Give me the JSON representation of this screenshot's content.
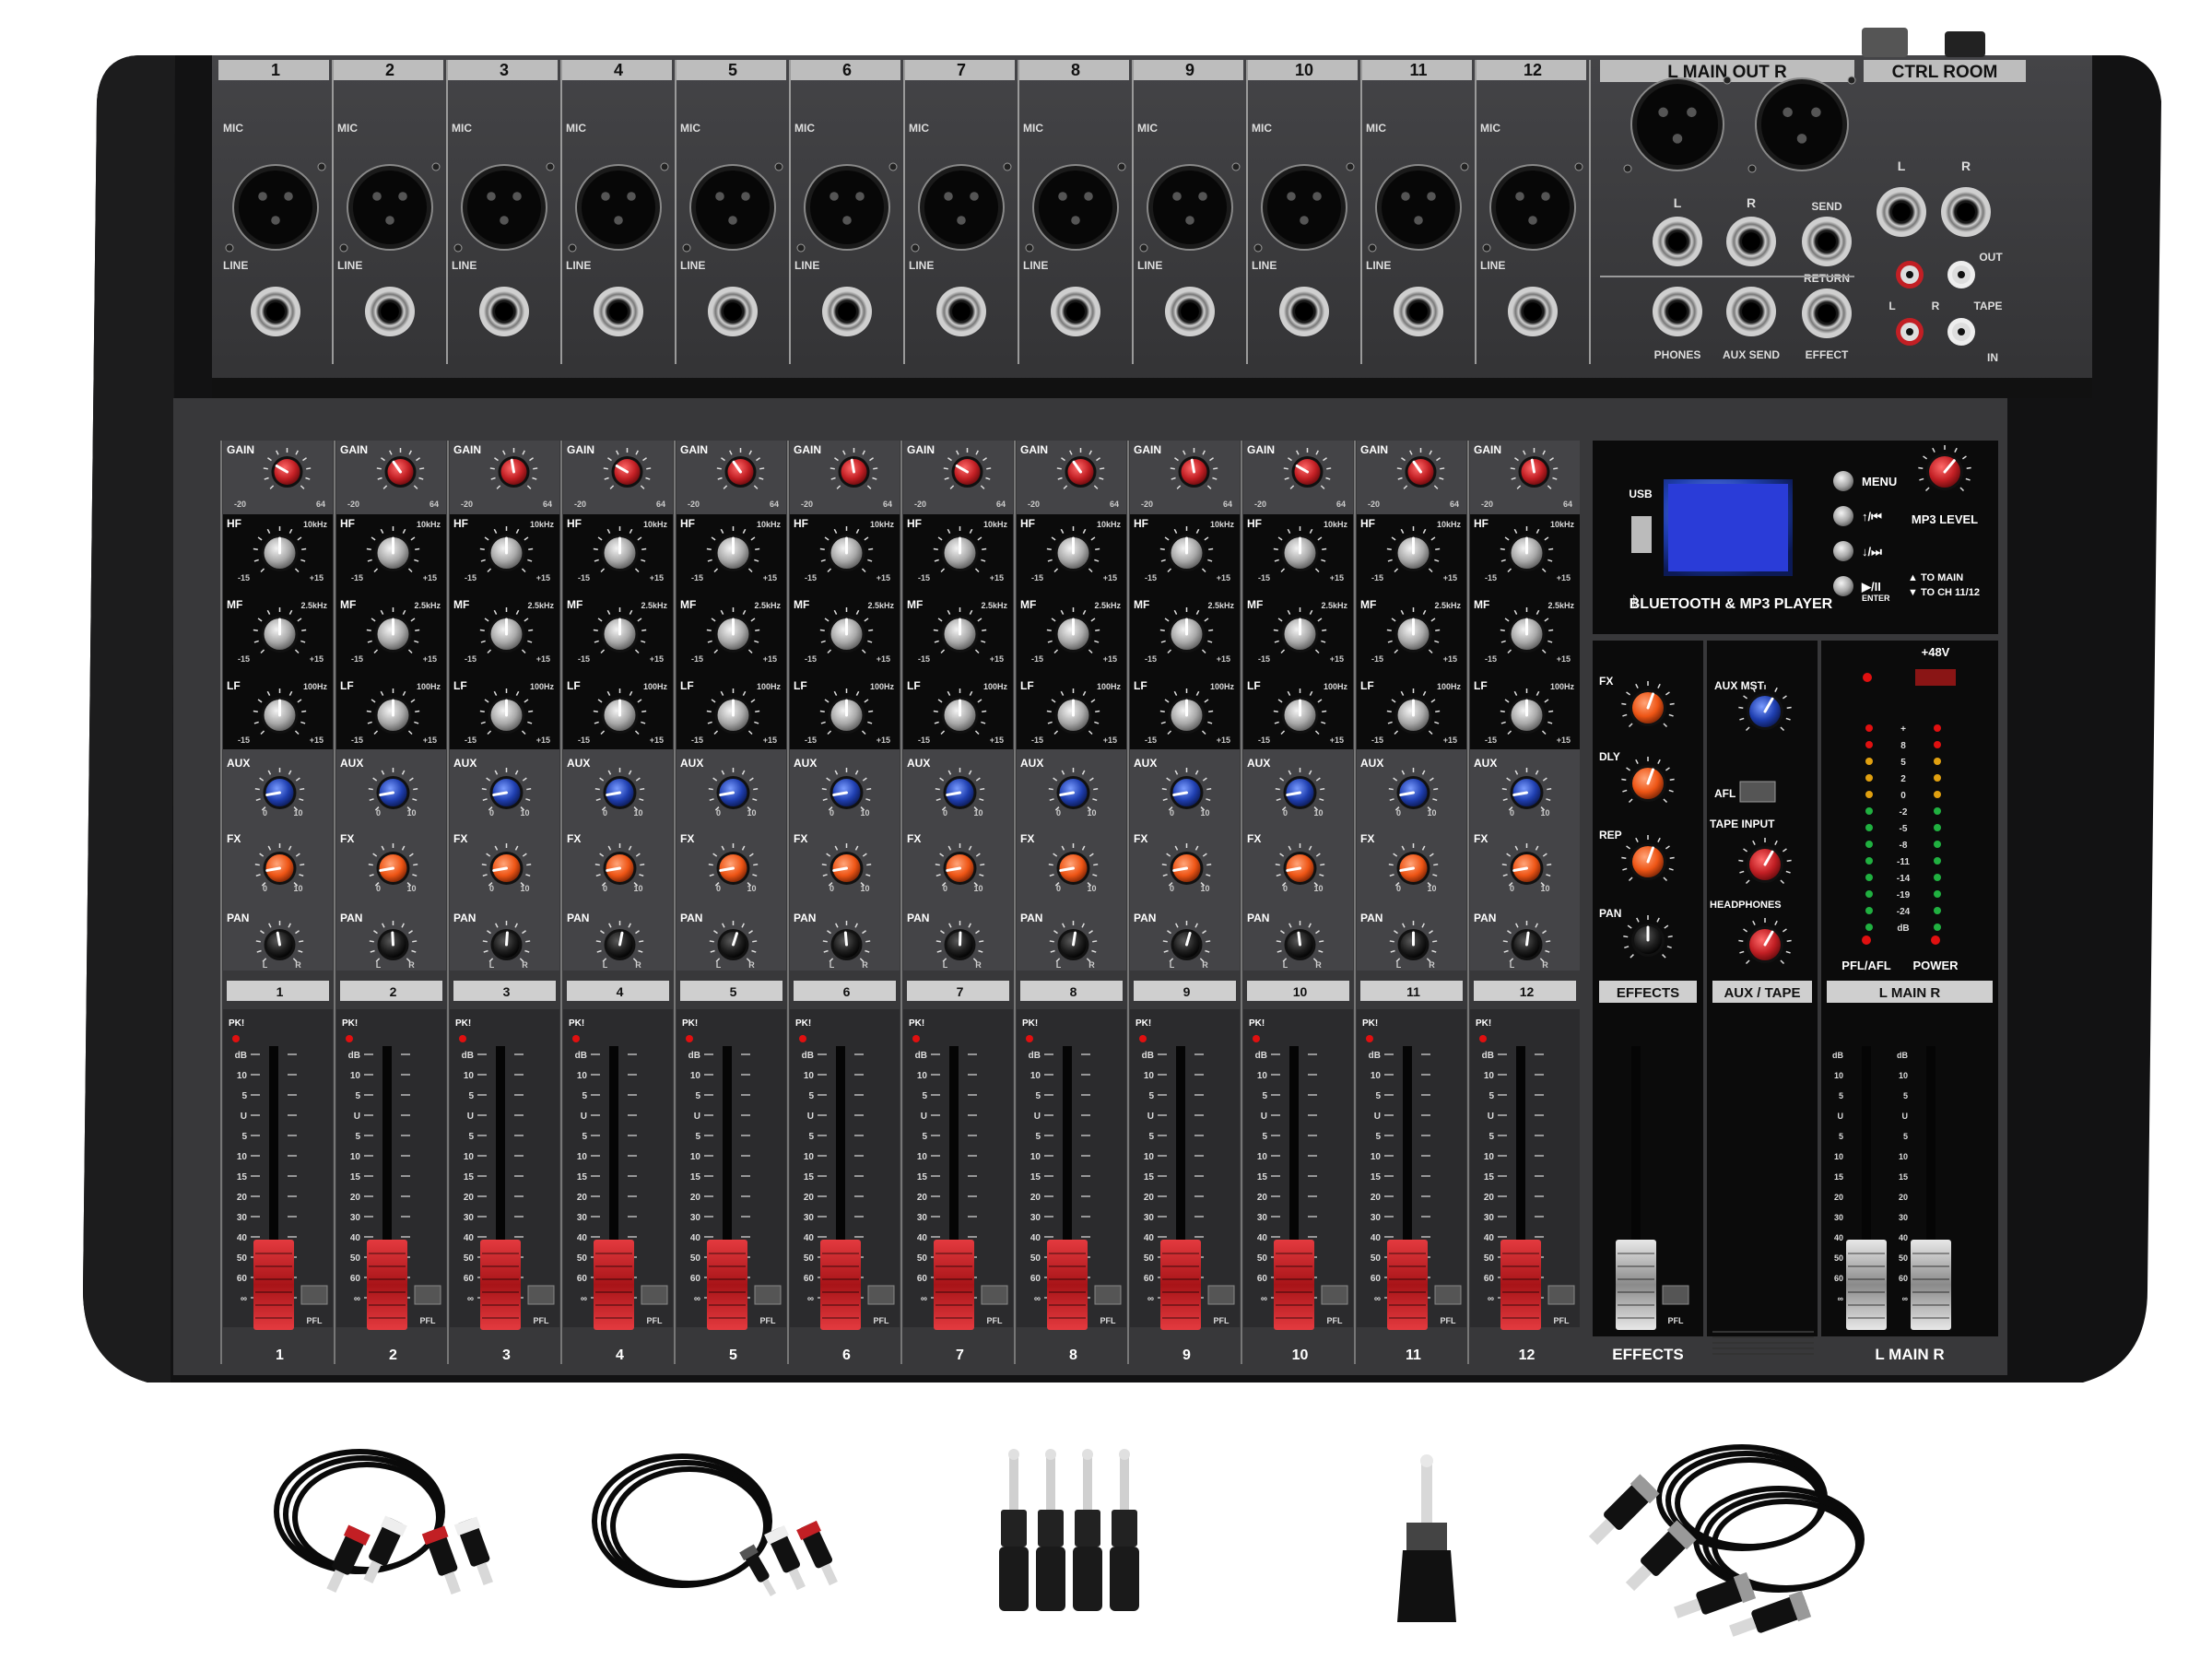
{
  "channels": [
    "1",
    "2",
    "3",
    "4",
    "5",
    "6",
    "7",
    "8",
    "9",
    "10",
    "11",
    "12"
  ],
  "input_labels": {
    "mic": "MIC",
    "line": "LINE"
  },
  "main_out": {
    "title": "L MAIN OUT R",
    "l": "L",
    "r": "R"
  },
  "ctrl_room": {
    "title": "CTRL ROOM",
    "l": "L",
    "r": "R",
    "out": "OUT",
    "tape": "TAPE",
    "in": "IN",
    "rca_l": "L",
    "rca_r": "R"
  },
  "jack_labels": {
    "send": "SEND",
    "return": "RETURN",
    "phones": "PHONES",
    "aux_send": "AUX SEND",
    "effect": "EFFECT"
  },
  "knob_labels": {
    "gain": "GAIN",
    "hf": "HF",
    "mf": "MF",
    "lf": "LF",
    "aux": "AUX",
    "fx": "FX",
    "pan": "PAN",
    "pk": "PK!",
    "pfl": "PFL"
  },
  "freq_labels": {
    "hf": "10kHz",
    "mf": "2.5kHz",
    "lf": "100Hz"
  },
  "scale_labels": {
    "eq_min": "-15",
    "eq_max": "+15",
    "send_min": "0",
    "send_max": "10",
    "pan_l": "L",
    "pan_r": "R",
    "gain_min": "-20",
    "gain_max": "64"
  },
  "fader_scale": [
    "dB",
    "10",
    "5",
    "U",
    "5",
    "10",
    "15",
    "20",
    "30",
    "40",
    "50",
    "60",
    "∞"
  ],
  "mp3": {
    "usb": "USB",
    "menu": "MENU",
    "prev": "↑/⏮",
    "next": "↓/⏭",
    "play": "▶/II",
    "enter": "ENTER",
    "level": "MP3 LEVEL",
    "to_main": "▲ TO MAIN",
    "to_ch": "▼ TO CH 11/12",
    "title": "BLUETOOTH & MP3 PLAYER",
    "bt_icon": "bluetooth-icon"
  },
  "effects": {
    "fx": "FX",
    "dly": "DLY",
    "rep": "REP",
    "pan": "PAN",
    "label": "EFFECTS",
    "bottom": "EFFECTS"
  },
  "aux_section": {
    "aux_mst": "AUX MST",
    "afl": "AFL",
    "tape_input": "TAPE INPUT",
    "headphones": "HEADPHONES",
    "label": "AUX / TAPE"
  },
  "meter": {
    "phantom": "+48V",
    "levels": [
      "+",
      "8",
      "5",
      "2",
      "0",
      "-2",
      "-5",
      "-8",
      "-11",
      "-14",
      "-19",
      "-24",
      "dB"
    ],
    "pfl_afl": "PFL/AFL",
    "power": "POWER"
  },
  "main_section": {
    "label": "L  MAIN  R",
    "bottom": "L  MAIN  R"
  },
  "colors": {
    "panel": "#3a3a3c",
    "body": "#111111",
    "strip": "#2a2a2c",
    "gain_knob": "#c21f24",
    "aux_knob": "#1f3fb0",
    "fx_knob": "#ee5515",
    "fader_red": "#c41e24",
    "lcd": "#2a3cd8"
  },
  "accessories": [
    "rca-cable-icon",
    "rca-to-35mm-cable-icon",
    "quarter-inch-adapters-icon",
    "35mm-to-quarter-inch-adapter-icon",
    "xlr-cables-icon"
  ]
}
